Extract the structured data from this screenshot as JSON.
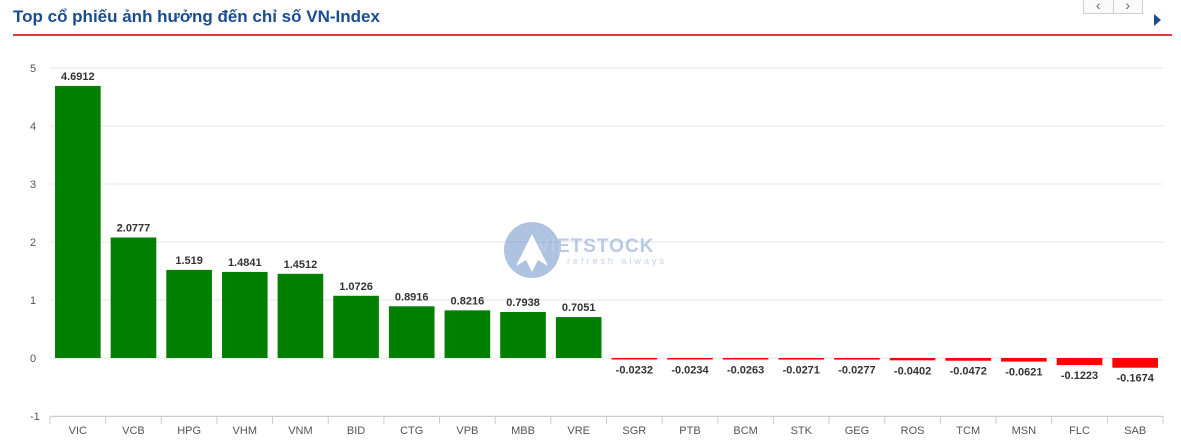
{
  "header": {
    "title": "Top cổ phiếu ảnh hưởng đến chỉ số VN-Index",
    "prev_label": "‹",
    "next_label": "›",
    "expand_icon": "triangle-right-icon"
  },
  "watermark": {
    "brand": "VIETSTOCK",
    "tagline": "refresh always"
  },
  "colors": {
    "positive": "#008000",
    "negative": "#ff0000",
    "title": "#1a4d8f",
    "rule": "#e03b3b"
  },
  "chart_data": {
    "type": "bar",
    "title": "",
    "xlabel": "",
    "ylabel": "",
    "ylim": [
      -1,
      5
    ],
    "yticks": [
      -1,
      0,
      1,
      2,
      3,
      4,
      5
    ],
    "grid": true,
    "categories": [
      "VIC",
      "VCB",
      "HPG",
      "VHM",
      "VNM",
      "BID",
      "CTG",
      "VPB",
      "MBB",
      "VRE",
      "SGR",
      "PTB",
      "BCM",
      "STK",
      "GEG",
      "ROS",
      "TCM",
      "MSN",
      "FLC",
      "SAB"
    ],
    "values": [
      4.6912,
      2.0777,
      1.519,
      1.4841,
      1.4512,
      1.0726,
      0.8916,
      0.8216,
      0.7938,
      0.7051,
      -0.0232,
      -0.0234,
      -0.0263,
      -0.0271,
      -0.0277,
      -0.0402,
      -0.0472,
      -0.0621,
      -0.1223,
      -0.1674
    ],
    "value_labels": [
      "4.6912",
      "2.0777",
      "1.519",
      "1.4841",
      "1.4512",
      "1.0726",
      "0.8916",
      "0.8216",
      "0.7938",
      "0.7051",
      "-0.0232",
      "-0.0234",
      "-0.0263",
      "-0.0271",
      "-0.0277",
      "-0.0402",
      "-0.0472",
      "-0.0621",
      "-0.1223",
      "-0.1674"
    ]
  }
}
